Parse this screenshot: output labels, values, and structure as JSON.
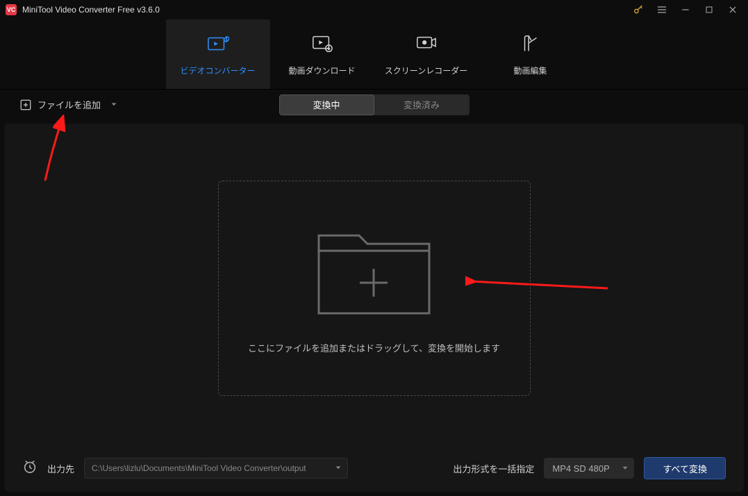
{
  "titlebar": {
    "app_icon_text": "VC",
    "title": "MiniTool Video Converter Free v3.6.0"
  },
  "nav": {
    "tabs": [
      {
        "label": "ビデオコンバーター"
      },
      {
        "label": "動画ダウンロード"
      },
      {
        "label": "スクリーンレコーダー"
      },
      {
        "label": "動画編集"
      }
    ]
  },
  "subbar": {
    "add_files_label": "ファイルを追加",
    "seg": {
      "converting": "変換中",
      "converted": "変換済み"
    }
  },
  "dropzone": {
    "hint": "ここにファイルを追加またはドラッグして、変換を開始します"
  },
  "bottombar": {
    "output_label": "出力先",
    "output_path": "C:\\Users\\lizlu\\Documents\\MiniTool Video Converter\\output",
    "format_label": "出力形式を一括指定",
    "format_value": "MP4 SD 480P",
    "convert_all": "すべて変換"
  }
}
